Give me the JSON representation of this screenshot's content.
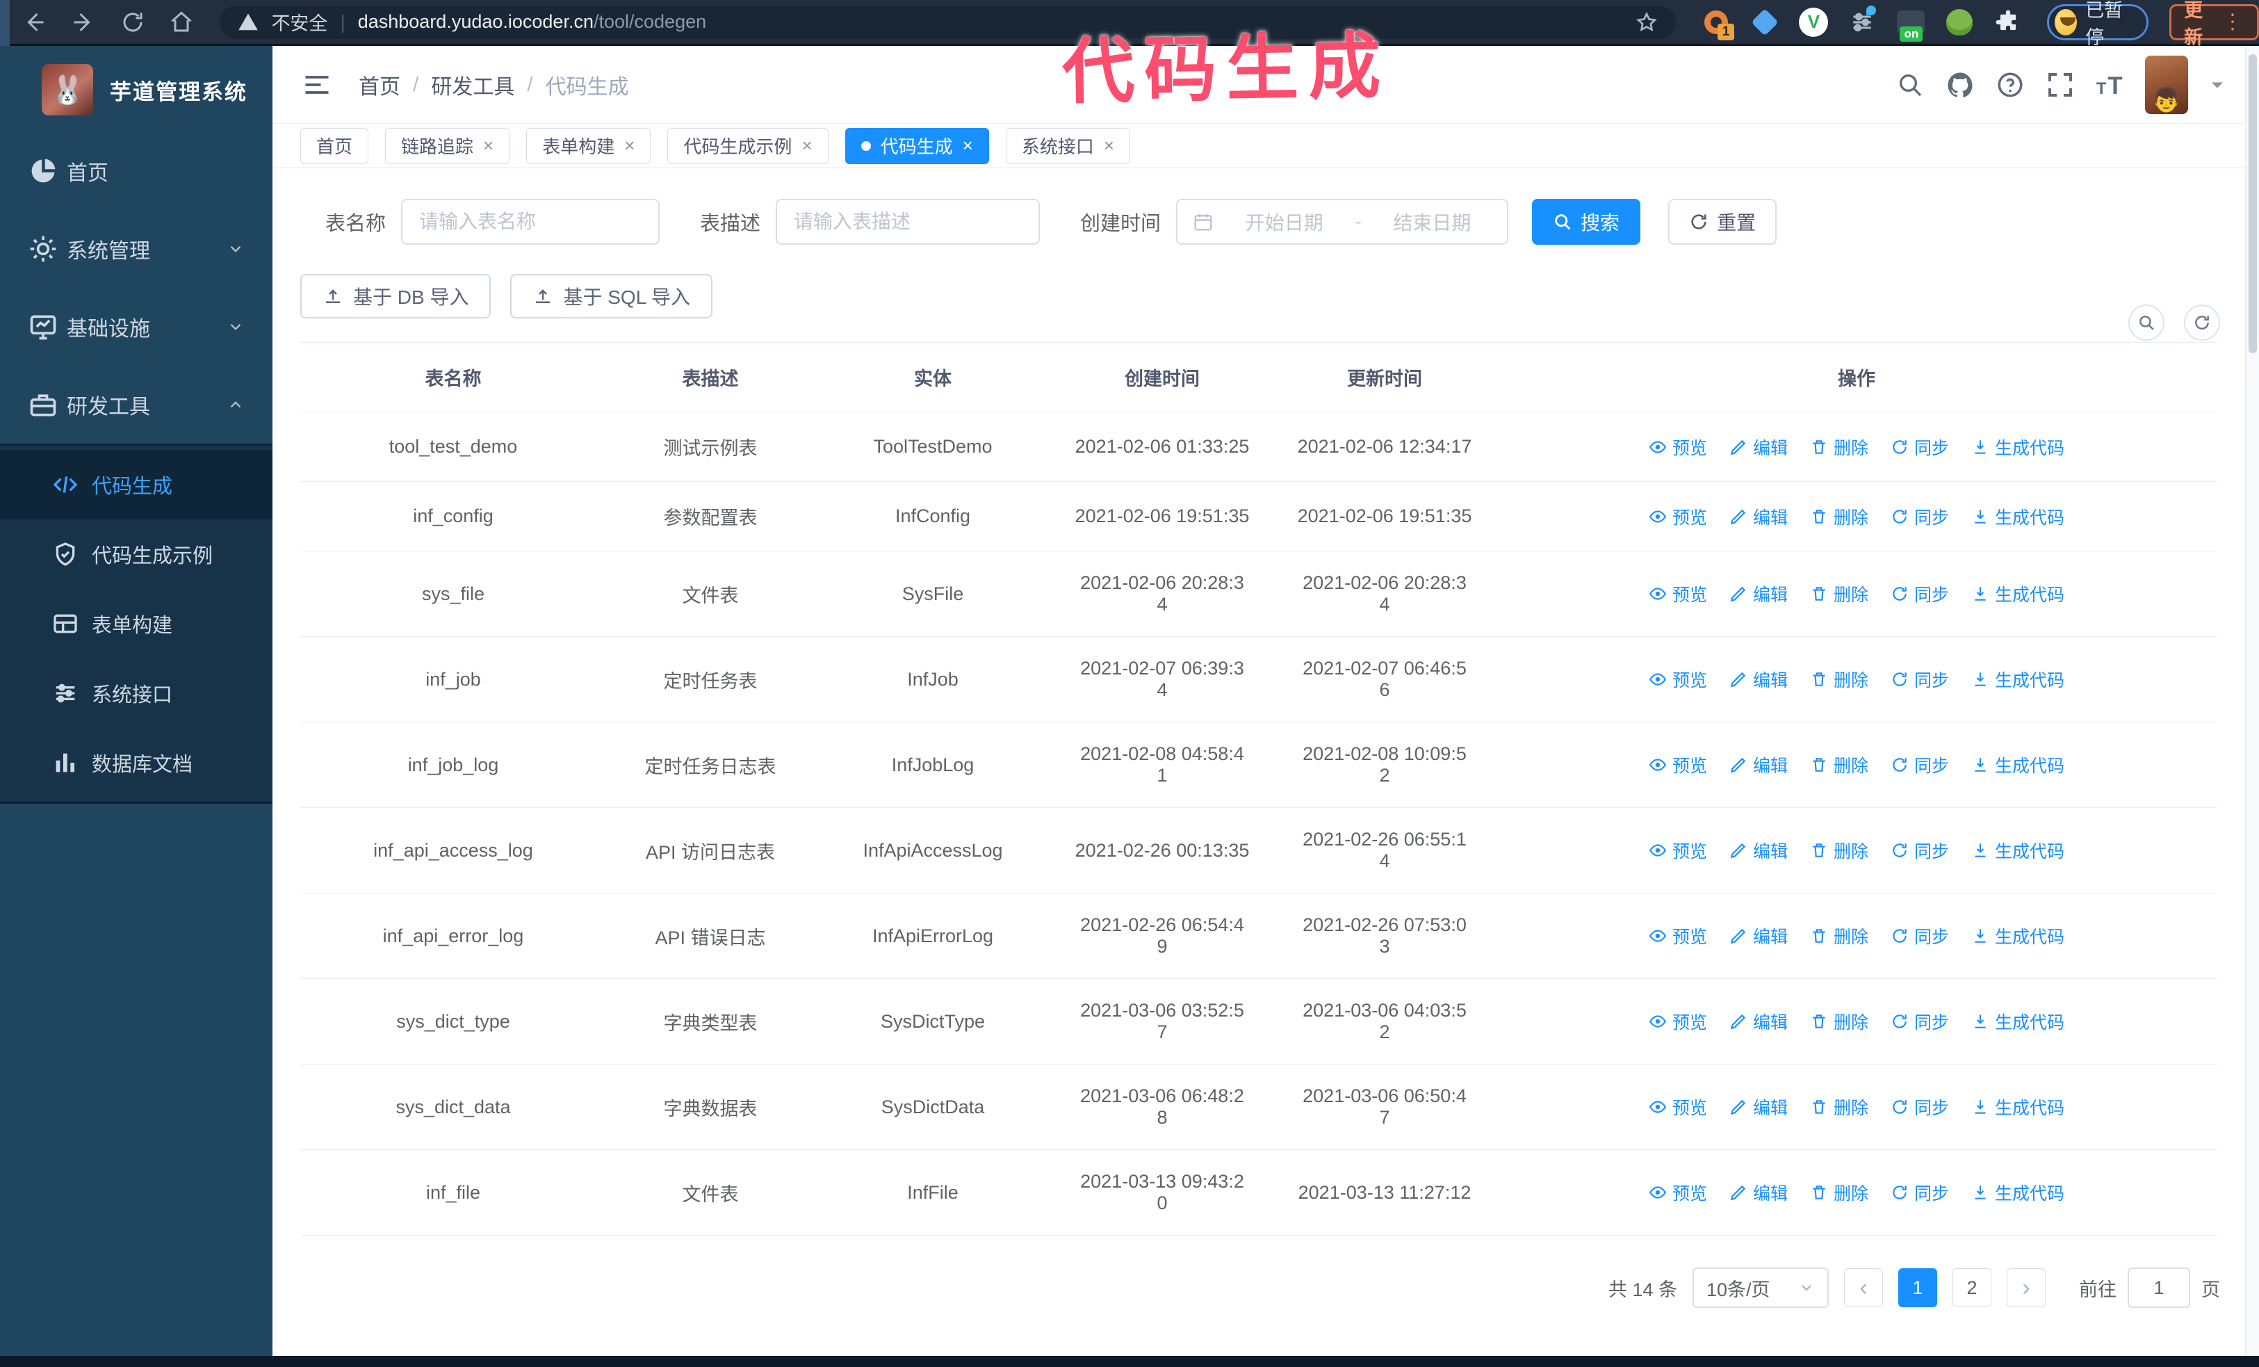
{
  "browser": {
    "not_secure": "不安全",
    "url_host": "dashboard.yudao.iocoder.cn",
    "url_path": "/tool/codegen",
    "ext_badge": "1",
    "ext_on_label": "on",
    "profile_label": "已暂停",
    "update_label": "更新"
  },
  "annotation": {
    "text": "代码生成",
    "color": "#fb4d6e"
  },
  "sidebar": {
    "app_title": "芋道管理系统",
    "menu": [
      {
        "label": "首页",
        "icon": "dashboard",
        "chevron": ""
      },
      {
        "label": "系统管理",
        "icon": "gear",
        "chevron": "down"
      },
      {
        "label": "基础设施",
        "icon": "monitor",
        "chevron": "down"
      },
      {
        "label": "研发工具",
        "icon": "briefcase",
        "chevron": "up"
      }
    ],
    "submenu": [
      {
        "label": "代码生成",
        "icon": "code",
        "active": true
      },
      {
        "label": "代码生成示例",
        "icon": "shield",
        "active": false
      },
      {
        "label": "表单构建",
        "icon": "form",
        "active": false
      },
      {
        "label": "系统接口",
        "icon": "sliders",
        "active": false
      },
      {
        "label": "数据库文档",
        "icon": "columns",
        "active": false
      }
    ]
  },
  "header": {
    "breadcrumb": [
      "首页",
      "研发工具",
      "代码生成"
    ]
  },
  "tabs": [
    {
      "label": "首页",
      "closable": false,
      "active": false
    },
    {
      "label": "链路追踪",
      "closable": true,
      "active": false
    },
    {
      "label": "表单构建",
      "closable": true,
      "active": false
    },
    {
      "label": "代码生成示例",
      "closable": true,
      "active": false
    },
    {
      "label": "代码生成",
      "closable": true,
      "active": true
    },
    {
      "label": "系统接口",
      "closable": true,
      "active": false
    }
  ],
  "filters": {
    "name_label": "表名称",
    "name_placeholder": "请输入表名称",
    "desc_label": "表描述",
    "desc_placeholder": "请输入表描述",
    "time_label": "创建时间",
    "start_placeholder": "开始日期",
    "range_separator": "-",
    "end_placeholder": "结束日期",
    "search_label": "搜索",
    "reset_label": "重置"
  },
  "toolbar": {
    "import_db": "基于 DB 导入",
    "import_sql": "基于 SQL 导入"
  },
  "table": {
    "headers": [
      "表名称",
      "表描述",
      "实体",
      "创建时间",
      "更新时间",
      "操作"
    ],
    "actions": [
      "预览",
      "编辑",
      "删除",
      "同步",
      "生成代码"
    ],
    "rows": [
      {
        "name": "tool_test_demo",
        "desc": "测试示例表",
        "entity": "ToolTestDemo",
        "create": "2021-02-06 01:33:25",
        "update": "2021-02-06 12:34:17"
      },
      {
        "name": "inf_config",
        "desc": "参数配置表",
        "entity": "InfConfig",
        "create": "2021-02-06 19:51:35",
        "update": "2021-02-06 19:51:35"
      },
      {
        "name": "sys_file",
        "desc": "文件表",
        "entity": "SysFile",
        "create": "2021-02-06 20:28:3\n4",
        "update": "2021-02-06 20:28:3\n4"
      },
      {
        "name": "inf_job",
        "desc": "定时任务表",
        "entity": "InfJob",
        "create": "2021-02-07 06:39:3\n4",
        "update": "2021-02-07 06:46:5\n6"
      },
      {
        "name": "inf_job_log",
        "desc": "定时任务日志表",
        "entity": "InfJobLog",
        "create": "2021-02-08 04:58:4\n1",
        "update": "2021-02-08 10:09:5\n2"
      },
      {
        "name": "inf_api_access_log",
        "desc": "API 访问日志表",
        "entity": "InfApiAccessLog",
        "create": "2021-02-26 00:13:35",
        "update": "2021-02-26 06:55:1\n4"
      },
      {
        "name": "inf_api_error_log",
        "desc": "API 错误日志",
        "entity": "InfApiErrorLog",
        "create": "2021-02-26 06:54:4\n9",
        "update": "2021-02-26 07:53:0\n3"
      },
      {
        "name": "sys_dict_type",
        "desc": "字典类型表",
        "entity": "SysDictType",
        "create": "2021-03-06 03:52:5\n7",
        "update": "2021-03-06 04:03:5\n2"
      },
      {
        "name": "sys_dict_data",
        "desc": "字典数据表",
        "entity": "SysDictData",
        "create": "2021-03-06 06:48:2\n8",
        "update": "2021-03-06 06:50:4\n7"
      },
      {
        "name": "inf_file",
        "desc": "文件表",
        "entity": "InfFile",
        "create": "2021-03-13 09:43:2\n0",
        "update": "2021-03-13 11:27:12"
      }
    ]
  },
  "pagination": {
    "total": "共 14 条",
    "page_size": "10条/页",
    "pages": [
      "1",
      "2"
    ],
    "active_page": "1",
    "goto_label": "前往",
    "goto_value": "1",
    "page_suffix": "页"
  }
}
